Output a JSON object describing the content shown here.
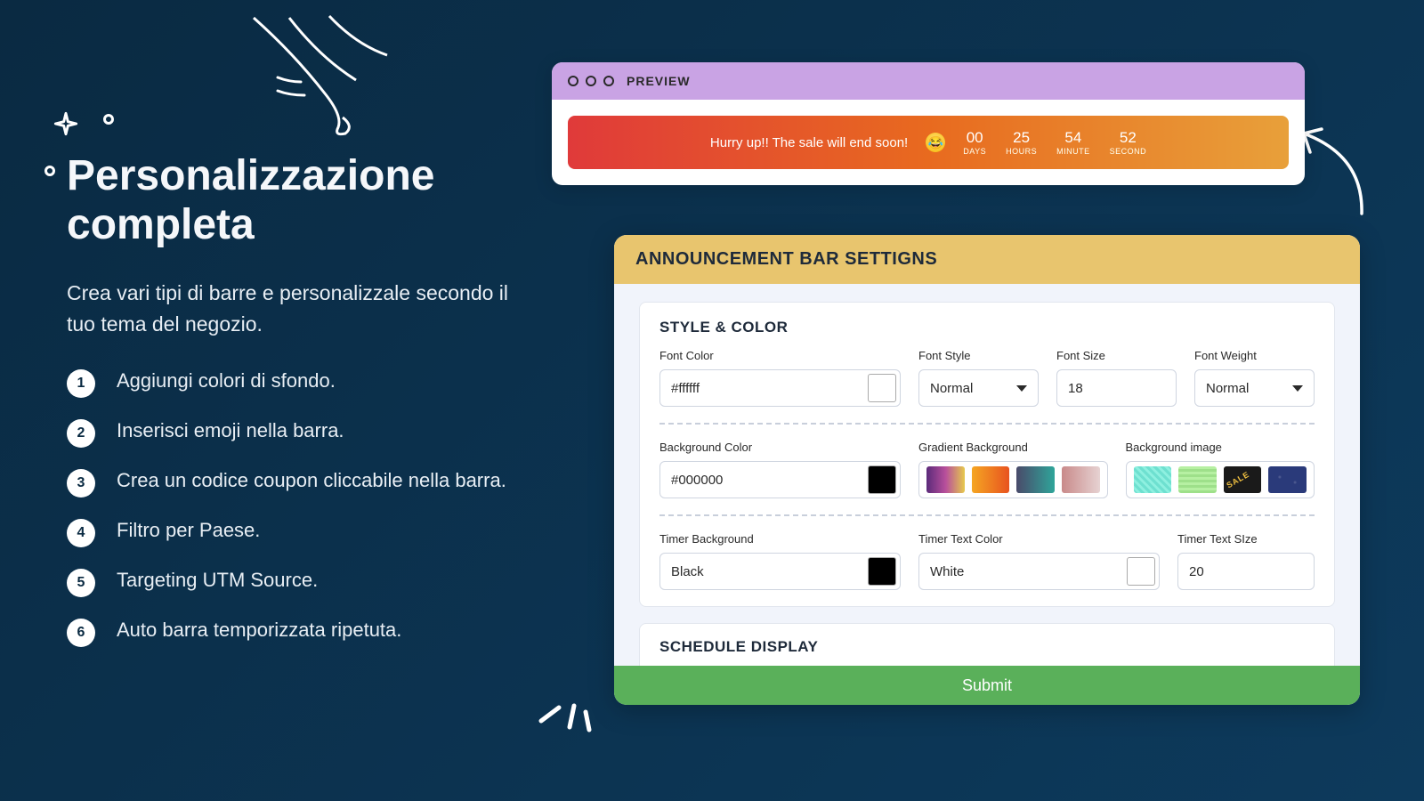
{
  "title": "Personalizzazione completa",
  "subtitle": "Crea vari tipi di barre e personalizzale secondo il tuo tema del negozio.",
  "list": [
    "Aggiungi colori di sfondo.",
    "Inserisci emoji nella barra.",
    "Crea un codice coupon cliccabile nella barra.",
    "Filtro per Paese.",
    "Targeting UTM Source.",
    "Auto barra temporizzata ripetuta."
  ],
  "preview": {
    "label": "PREVIEW",
    "message": "Hurry up!! The sale will end soon!",
    "timer": [
      {
        "value": "00",
        "label": "DAYS"
      },
      {
        "value": "25",
        "label": "HOURS"
      },
      {
        "value": "54",
        "label": "MINUTE"
      },
      {
        "value": "52",
        "label": "SECOND"
      }
    ]
  },
  "settings": {
    "header": "ANNOUNCEMENT BAR SETTIGNS",
    "style_section": "STYLE & COLOR",
    "labels": {
      "font_color": "Font Color",
      "font_style": "Font Style",
      "font_size": "Font Size",
      "font_weight": "Font Weight",
      "background_color": "Background Color",
      "gradient_background": "Gradient Background",
      "background_image": "Background image",
      "timer_background": "Timer Background",
      "timer_text_color": "Timer Text Color",
      "timer_text_size": "Timer Text SIze"
    },
    "values": {
      "font_color": "#ffffff",
      "font_style": "Normal",
      "font_size": "18",
      "font_weight": "Normal",
      "background_color": "#000000",
      "timer_background": "Black",
      "timer_text_color": "White",
      "timer_text_size": "20"
    },
    "schedule_section": "SCHEDULE DISPLAY",
    "submit": "Submit"
  }
}
